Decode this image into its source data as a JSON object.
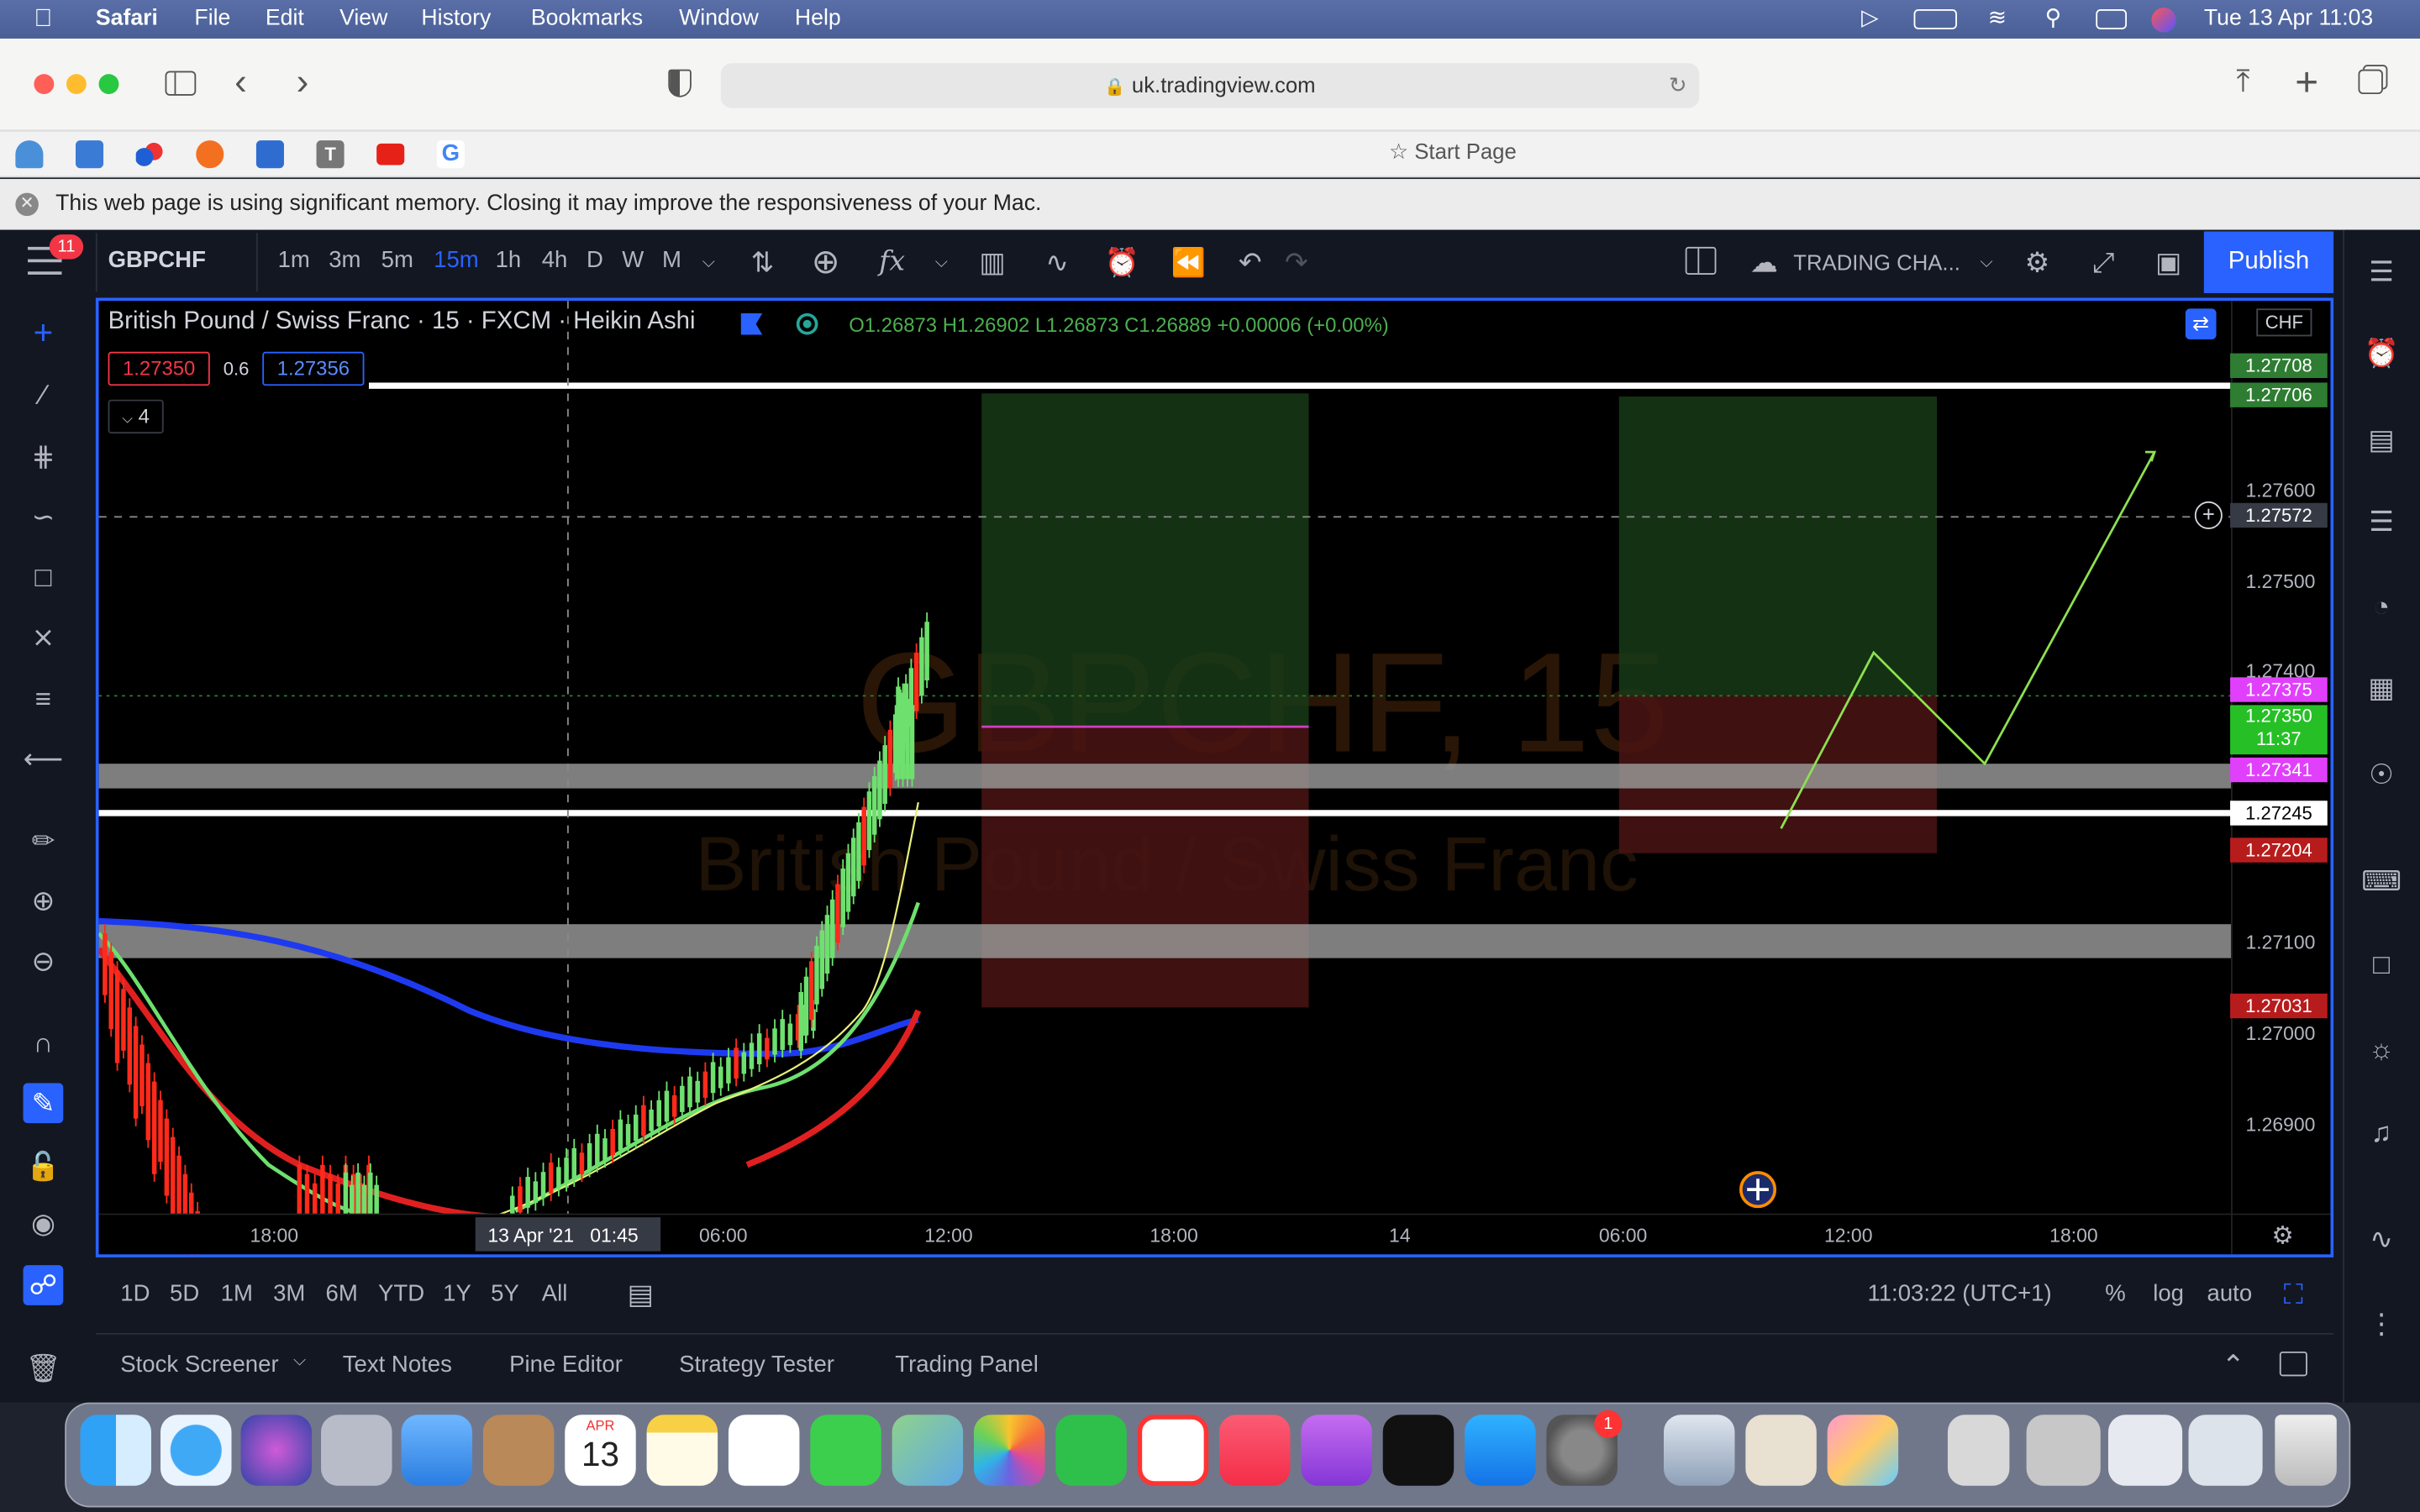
{
  "menubar": {
    "app": "Safari",
    "items": [
      "File",
      "Edit",
      "View",
      "History",
      "Bookmarks",
      "Window",
      "Help"
    ],
    "clock": "Tue 13 Apr  11:03"
  },
  "safari": {
    "url": "uk.tradingview.com",
    "start_page": "Start Page",
    "warning": "This web page is using significant memory. Closing it may improve the responsiveness of your Mac."
  },
  "tv": {
    "notif_count": "11",
    "symbol": "GBPCHF",
    "intervals": [
      "1m",
      "3m",
      "5m",
      "15m",
      "1h",
      "4h",
      "D",
      "W",
      "M"
    ],
    "active_interval": "15m",
    "layout_name": "TRADING CHA...",
    "publish": "Publish",
    "legend": {
      "title": "British Pound / Swiss Franc · 15 · FXCM · Heikin Ashi",
      "ohlc": "O1.26873  H1.26902  L1.26873  C1.26889  +0.00006 (+0.00%)",
      "sell": "1.27350",
      "spread": "0.6",
      "buy": "1.27356",
      "collapsed_count": "4"
    },
    "watermark": {
      "symbol": "GBPCHF, 15",
      "name": "British Pound / Swiss Franc"
    },
    "currency": "CHF",
    "price_ticks": [
      "1.27600",
      "1.27500",
      "1.27400",
      "1.27100",
      "1.27000",
      "1.26900"
    ],
    "price_boxes": {
      "top1": "1.27708",
      "top2": "1.27706",
      "crosshair": "1.27572",
      "magenta1": "1.27375",
      "current": "1.27350",
      "countdown": "11:37",
      "magenta2": "1.27341",
      "white": "1.27245",
      "red1": "1.27204",
      "red2": "1.27031"
    },
    "time_ticks": [
      "18:00",
      "06:00",
      "12:00",
      "18:00",
      "14",
      "06:00",
      "12:00",
      "18:00"
    ],
    "crosshair_time": "13 Apr '21   01:45",
    "ranges": [
      "1D",
      "5D",
      "1M",
      "3M",
      "6M",
      "YTD",
      "1Y",
      "5Y",
      "All"
    ],
    "clock": "11:03:22 (UTC+1)",
    "scale_opts": [
      "%",
      "log",
      "auto"
    ],
    "bottom_tabs": [
      "Stock Screener",
      "Text Notes",
      "Pine Editor",
      "Strategy Tester",
      "Trading Panel"
    ]
  },
  "dock": {
    "calendar_month": "APR",
    "calendar_day": "13",
    "settings_badge": "1"
  }
}
